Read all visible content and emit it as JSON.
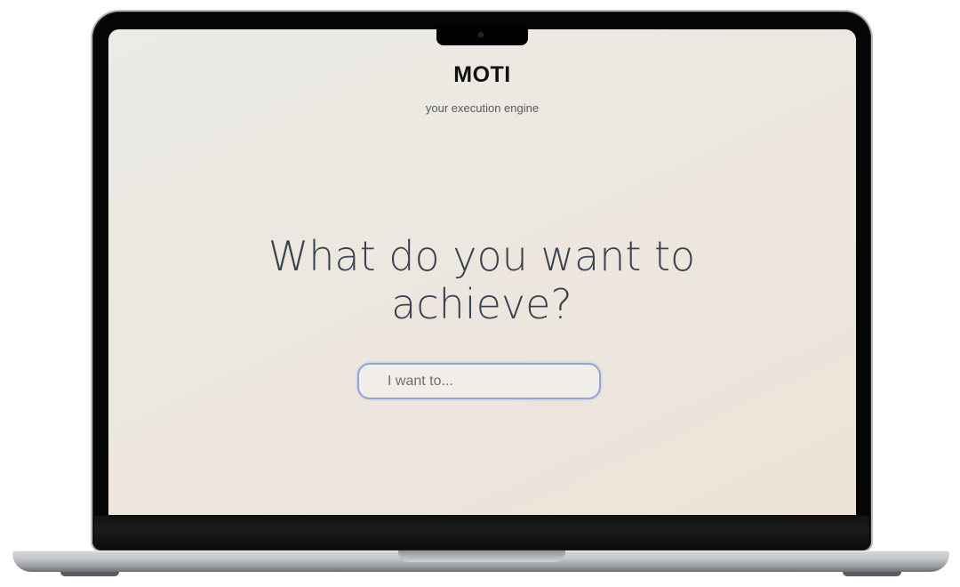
{
  "app": {
    "brand": "MOTI",
    "tagline": "your execution engine"
  },
  "main": {
    "headline": "What do you want to achieve?",
    "goal_input": {
      "placeholder": "I want to...",
      "value": ""
    }
  },
  "colors": {
    "background_start": "#ecebe7",
    "background_end": "#ede3d8",
    "headline": "#3b4350",
    "input_border": "#8fa6d6"
  }
}
